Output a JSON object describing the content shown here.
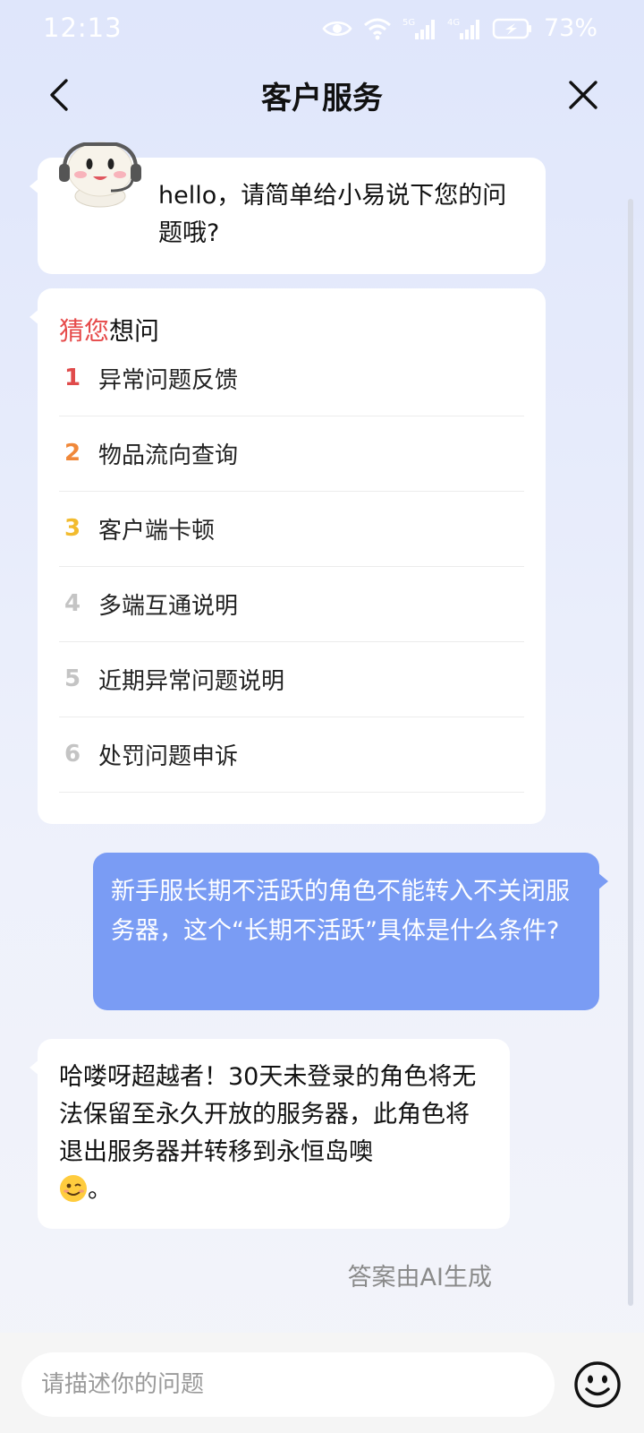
{
  "status_bar": {
    "time": "12:13",
    "network_1": "5G",
    "network_2": "4G",
    "battery": "73%"
  },
  "header": {
    "title": "客户服务"
  },
  "greeting": {
    "text": "hello，请简单给小易说下您的问题哦?"
  },
  "faq": {
    "title_highlight": "猜您",
    "title_rest": "想问",
    "items": [
      {
        "num": "1",
        "label": "异常问题反馈",
        "color": "#e04b4b"
      },
      {
        "num": "2",
        "label": "物品流向查询",
        "color": "#f0883a"
      },
      {
        "num": "3",
        "label": "客户端卡顿",
        "color": "#f2bb2e"
      },
      {
        "num": "4",
        "label": "多端互通说明",
        "color": "#c4c4c4"
      },
      {
        "num": "5",
        "label": "近期异常问题说明",
        "color": "#c4c4c4"
      },
      {
        "num": "6",
        "label": "处罚问题申诉",
        "color": "#c4c4c4"
      }
    ]
  },
  "user_message": {
    "text": "新手服长期不活跃的角色不能转入不关闭服务器，这个“长期不活跃”具体是什么条件?"
  },
  "bot_reply": {
    "text": "哈喽呀超越者！30天未登录的角色将无法保留至永久开放的服务器，此角色将退出服务器并转移到永恒岛噢",
    "suffix": "。",
    "emoji": "wink-emoji"
  },
  "ai_note": "答案由AI生成",
  "input": {
    "placeholder": "请描述你的问题"
  },
  "colors": {
    "user_bubble": "#7a9cf4",
    "highlight": "#e64a4a"
  }
}
